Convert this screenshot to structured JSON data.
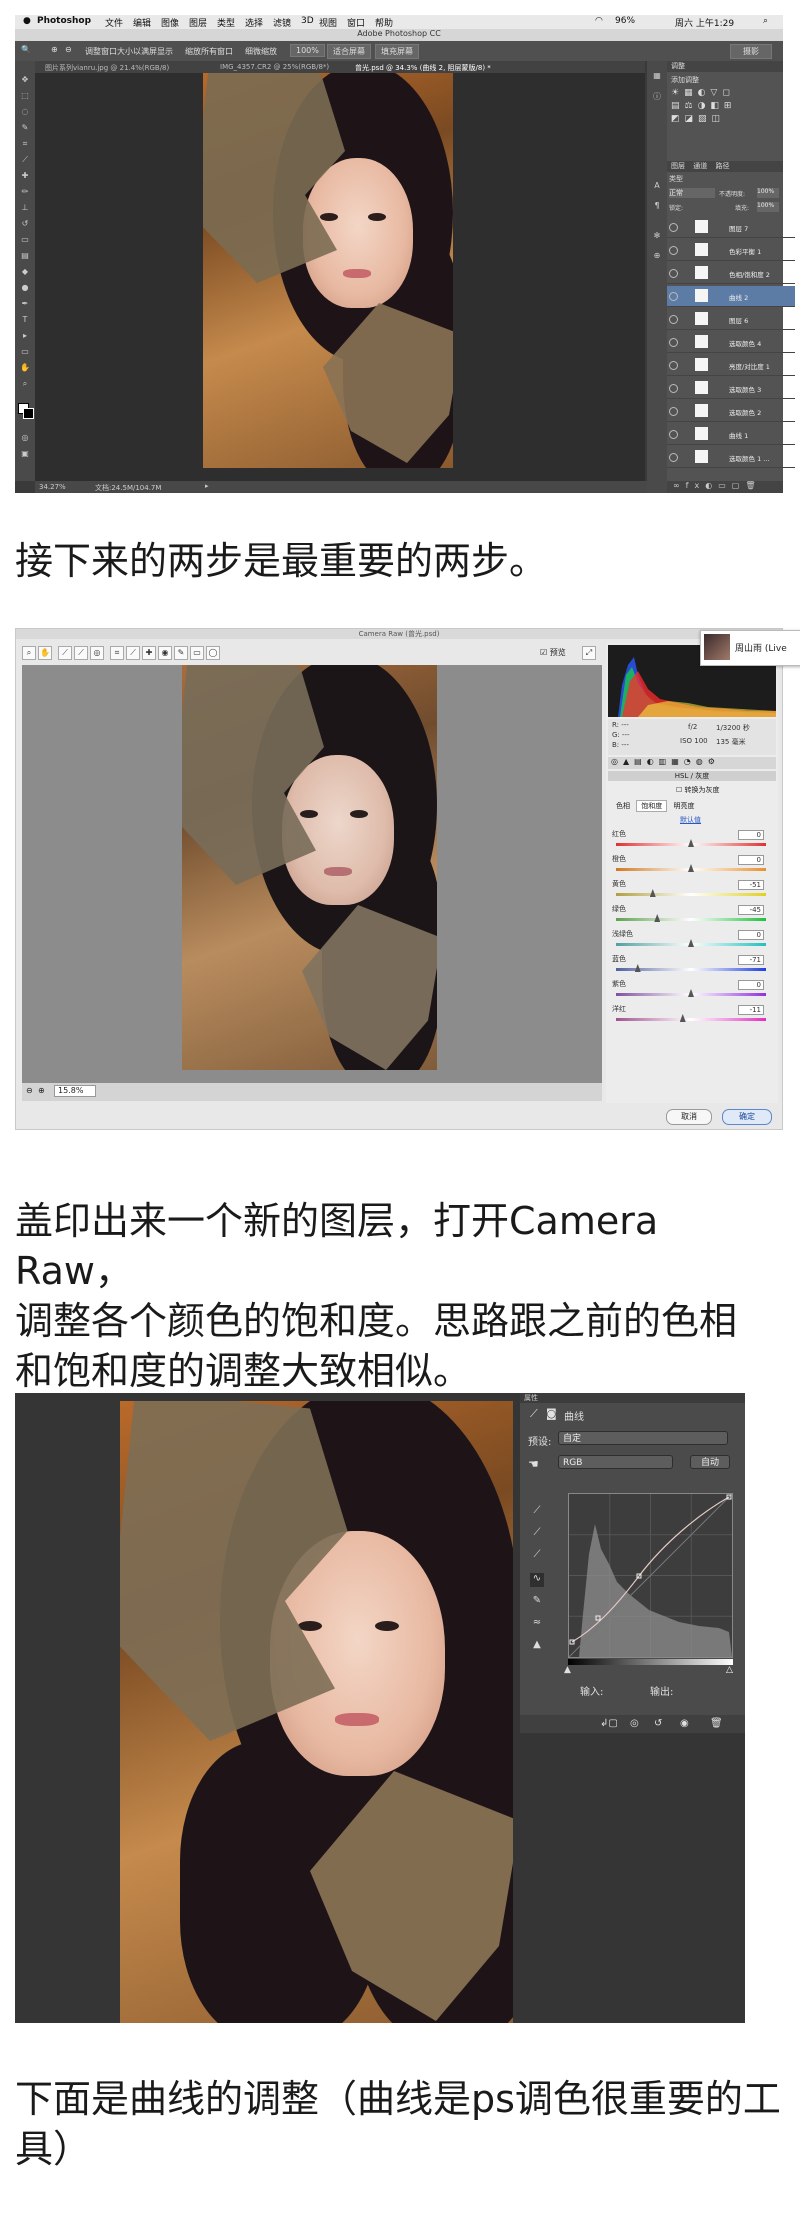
{
  "section1": {
    "menubar": {
      "apple": "",
      "app": "Photoshop",
      "items": [
        "文件",
        "编辑",
        "图像",
        "图层",
        "类型",
        "选择",
        "滤镜",
        "3D",
        "视图",
        "窗口",
        "帮助"
      ],
      "right_status": "96%",
      "clock": "周六 上午1:29"
    },
    "window_title": "Adobe Photoshop CC",
    "options": {
      "checkbox1": "调整窗口大小以满屏显示",
      "checkbox2": "缩放所有窗口",
      "checkbox3": "细微缩放",
      "zoom": "100%",
      "fit": "适合屏幕",
      "fill": "填充屏幕",
      "workspace": "摄影"
    },
    "tabs": [
      "图片系列vianru.jpg @ 21.4%(RGB/8)",
      "IMG_4357.CR2 @ 25%(RGB/8*)",
      "曾光.psd @ 34.3% (曲线 2, 阻层蒙版/8) *"
    ],
    "status_zoom": "34.27%",
    "status_doc": "文档:24.5M/104.7M",
    "panels": {
      "adjust_header": "调整",
      "adjust_sub": "添加调整",
      "layers_tabs": [
        "图层",
        "通道",
        "路径"
      ],
      "blend_mode": "正常",
      "opacity_label": "不透明度:",
      "opacity": "100%",
      "lock_label": "锁定:",
      "fill_label": "填充:",
      "fill": "100%",
      "kind": "类型",
      "layers": [
        {
          "name": "图层 7",
          "selected": false
        },
        {
          "name": "色彩平衡 1",
          "selected": false
        },
        {
          "name": "色相/饱和度 2",
          "selected": false
        },
        {
          "name": "曲线 2",
          "selected": true
        },
        {
          "name": "图层 6",
          "selected": false
        },
        {
          "name": "选取颜色 4",
          "selected": false
        },
        {
          "name": "亮度/对比度 1",
          "selected": false
        },
        {
          "name": "选取颜色 3",
          "selected": false
        },
        {
          "name": "选取颜色 2",
          "selected": false
        },
        {
          "name": "曲线 1",
          "selected": false
        },
        {
          "name": "选取颜色 1 ...",
          "selected": false
        }
      ]
    }
  },
  "caption1": "接下来的两步是最重要的两步。",
  "section2": {
    "title": "Camera Raw (曾光.psd)",
    "preview_label": "预览",
    "zoom": "15.8%",
    "info": {
      "r": "R:   ---",
      "g": "G:   ---",
      "b": "B:   ---",
      "aperture": "f/2",
      "shutter": "1/3200 秒",
      "iso": "ISO 100",
      "focal": "135 毫米"
    },
    "panel_title": "HSL / 灰度",
    "convert_gray": "转换为灰度",
    "sub_tabs": [
      "色相",
      "饱和度",
      "明亮度"
    ],
    "default_link": "默认值",
    "sliders": [
      {
        "label": "红色",
        "value": "0",
        "pos": 0.5,
        "colors": [
          "#e03030",
          "#ffffff",
          "#e03030"
        ]
      },
      {
        "label": "橙色",
        "value": "0",
        "pos": 0.5,
        "colors": [
          "#d07820",
          "#ffffff",
          "#e89030"
        ]
      },
      {
        "label": "黄色",
        "value": "-51",
        "pos": 0.245,
        "colors": [
          "#b0a040",
          "#ffffff",
          "#e0d020"
        ]
      },
      {
        "label": "绿色",
        "value": "-45",
        "pos": 0.275,
        "colors": [
          "#60a050",
          "#ffffff",
          "#20c040"
        ]
      },
      {
        "label": "浅绿色",
        "value": "0",
        "pos": 0.5,
        "colors": [
          "#50a0a0",
          "#ffffff",
          "#20c0c0"
        ]
      },
      {
        "label": "蓝色",
        "value": "-71",
        "pos": 0.145,
        "colors": [
          "#5060a0",
          "#ffffff",
          "#2040e0"
        ]
      },
      {
        "label": "紫色",
        "value": "0",
        "pos": 0.5,
        "colors": [
          "#8050a0",
          "#ffffff",
          "#9030e0"
        ]
      },
      {
        "label": "洋红",
        "value": "-11",
        "pos": 0.445,
        "colors": [
          "#a05090",
          "#ffffff",
          "#e030c0"
        ]
      }
    ],
    "cancel": "取消",
    "ok": "确定",
    "avatar_name": "周山雨 (Live"
  },
  "caption2": "盖印出来一个新的图层，打开Camera Raw，调整各个颜色的饱和度。思路跟之前的色相和饱和度的调整大致相似。",
  "caption2_lines": [
    "盖印出来一个新的图层，打开Camera Raw，",
    "调整各个颜色的饱和度。思路跟之前的色相",
    "和饱和度的调整大致相似。"
  ],
  "section3": {
    "panel_tab": "属性",
    "panel_name": "曲线",
    "preset_label": "预设:",
    "preset_value": "自定",
    "channel": "RGB",
    "auto": "自动",
    "input_label": "输入:",
    "output_label": "输出:"
  },
  "caption3_lines": [
    "下面是曲线的调整（曲线是ps调色很重要的工",
    "具）"
  ]
}
